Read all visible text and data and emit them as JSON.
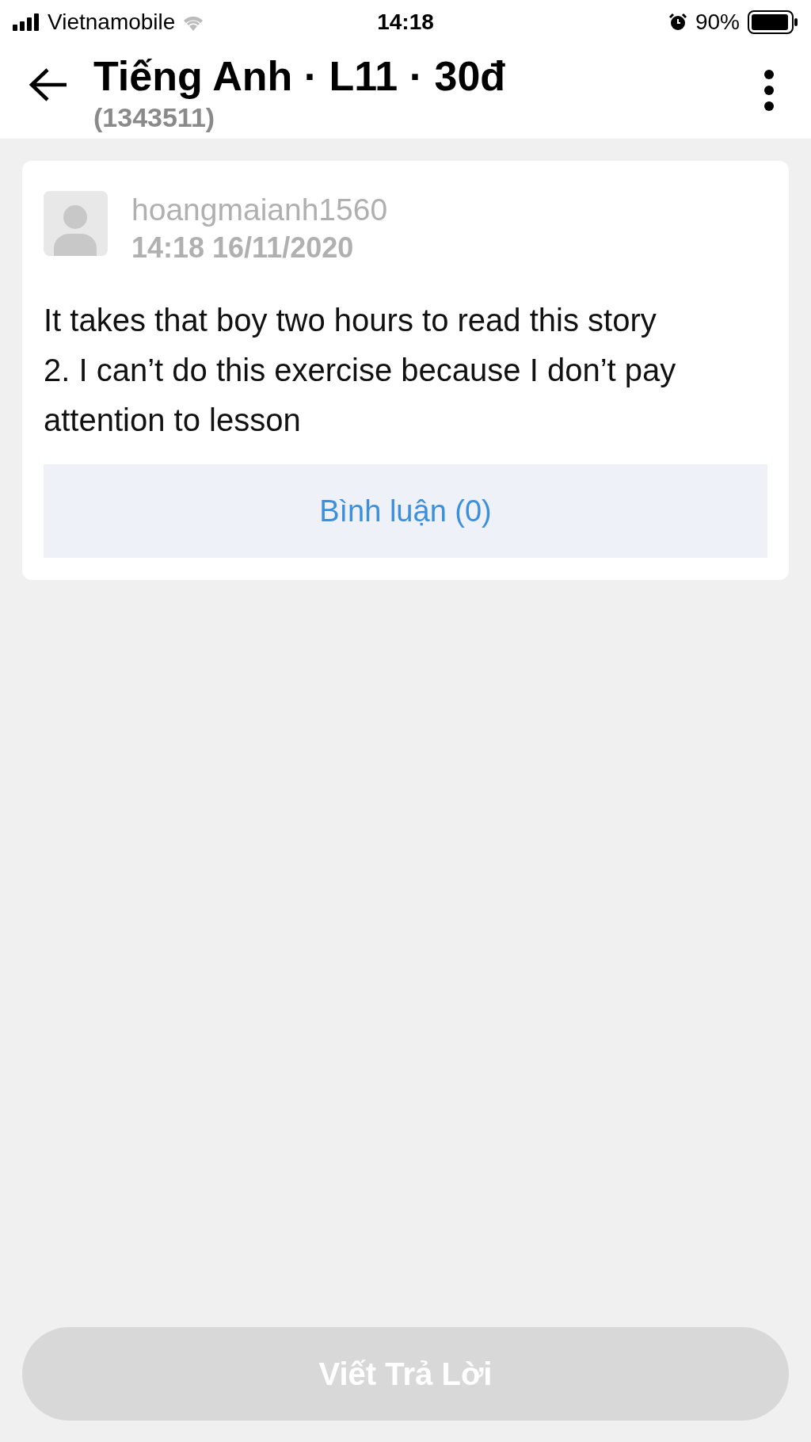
{
  "status_bar": {
    "carrier": "Vietnamobile",
    "time": "14:18",
    "battery": "90%"
  },
  "header": {
    "title": "Tiếng Anh · L11 · 30đ",
    "subtitle": "(1343511)"
  },
  "post": {
    "username": "hoangmaianh1560",
    "timestamp": "14:18 16/11/2020",
    "body": "It takes that boy two hours to read this story\n2. I can’t do this exercise because I don’t pay attention to lesson",
    "comment_button": "Bình luận (0)"
  },
  "reply_button": {
    "label": "Viết Trả Lời",
    "disabled": true
  }
}
